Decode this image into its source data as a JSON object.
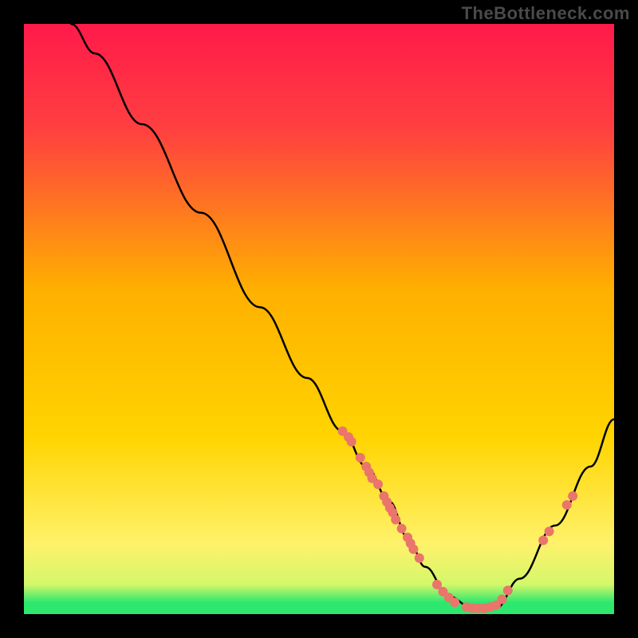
{
  "watermark": "TheBottleneck.com",
  "colors": {
    "background": "#000000",
    "gradient_top": "#ff1a4a",
    "gradient_mid": "#ffd400",
    "gradient_green": "#2ee86e",
    "curve": "#000000",
    "marker": "#e9756b",
    "watermark": "#4a4a4a"
  },
  "chart_data": {
    "type": "line",
    "title": "",
    "xlabel": "",
    "ylabel": "",
    "xlim": [
      0,
      100
    ],
    "ylim": [
      0,
      100
    ],
    "series": [
      {
        "name": "bottleneck-curve",
        "x": [
          8,
          12,
          20,
          30,
          40,
          48,
          54,
          58,
          62,
          65,
          68,
          72,
          76,
          80,
          84,
          90,
          96,
          100
        ],
        "y": [
          100,
          95,
          83,
          68,
          52,
          40,
          31,
          25,
          19,
          13,
          8,
          3,
          1,
          1,
          6,
          15,
          25,
          33
        ]
      }
    ],
    "markers": {
      "name": "highlight-points",
      "x": [
        54,
        55,
        55.5,
        57,
        58,
        58.5,
        59,
        60,
        61,
        61.5,
        62,
        62.5,
        63,
        64,
        65,
        65.5,
        66,
        67,
        70,
        71,
        72,
        73,
        75,
        76,
        77,
        78,
        79,
        80,
        81,
        82,
        88,
        89,
        92,
        93
      ],
      "y": [
        31,
        30,
        29.2,
        26.5,
        25,
        24,
        23,
        22,
        20,
        19,
        18,
        17.2,
        16,
        14.5,
        13,
        12,
        11,
        9.5,
        5,
        3.8,
        2.8,
        2,
        1.2,
        1,
        1,
        1,
        1.2,
        1.5,
        2.5,
        4,
        12.5,
        14,
        18.5,
        20
      ]
    }
  }
}
